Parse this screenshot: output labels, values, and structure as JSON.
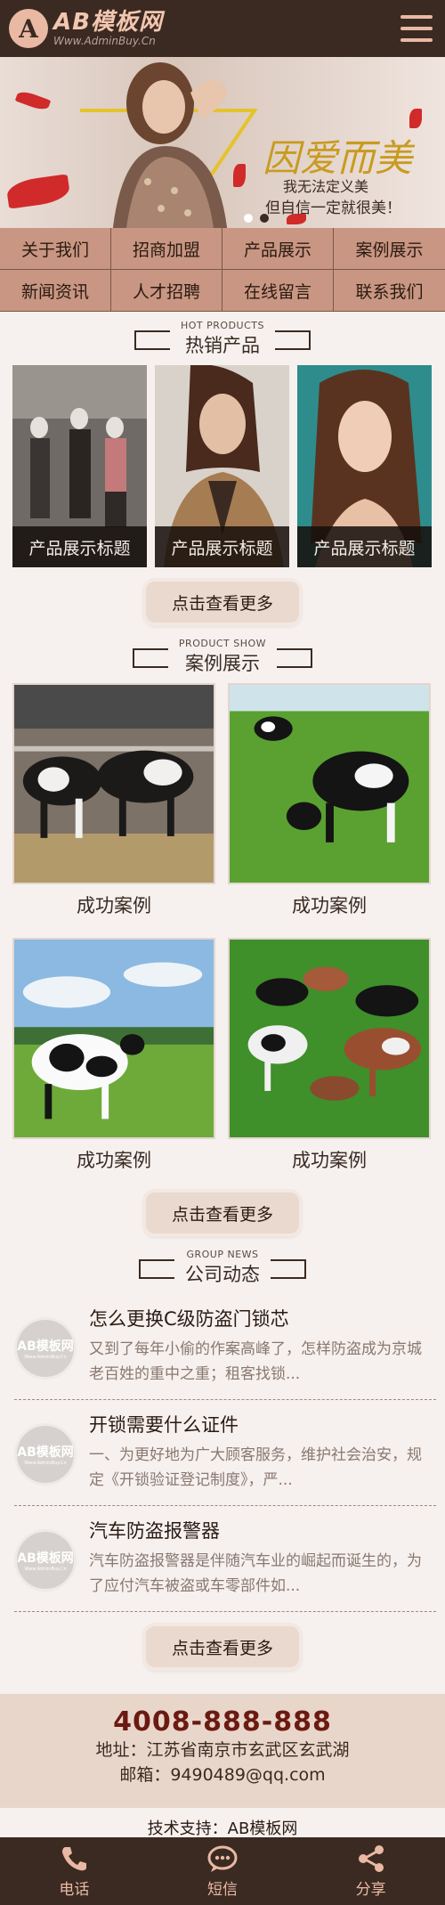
{
  "header": {
    "logo_mark": "A",
    "logo_name": "AB模板网",
    "logo_url": "Www.AdminBuy.Cn"
  },
  "banner": {
    "title": "因爱而美",
    "sub1": "我无法定义美",
    "sub2": "但自信一定就很美！"
  },
  "nav": [
    "关于我们",
    "招商加盟",
    "产品展示",
    "案例展示",
    "新闻资讯",
    "人才招聘",
    "在线留言",
    "联系我们"
  ],
  "hot": {
    "en": "HOT PRODUCTS",
    "cn": "热销产品",
    "items": [
      "产品展示标题",
      "产品展示标题",
      "产品展示标题"
    ],
    "more": "点击查看更多"
  },
  "cases": {
    "en": "PRODUCT SHOW",
    "cn": "案例展示",
    "items": [
      "成功案例",
      "成功案例",
      "成功案例",
      "成功案例"
    ],
    "more": "点击查看更多"
  },
  "news": {
    "en": "GROUP NEWS",
    "cn": "公司动态",
    "thumb_name": "AB模板网",
    "thumb_url": "Www.AdminBuy.Cn",
    "items": [
      {
        "title": "怎么更换C级防盗门锁芯",
        "desc": "又到了每年小偷的作案高峰了，怎样防盗成为京城老百姓的重中之重；租客找锁..."
      },
      {
        "title": "开锁需要什么证件",
        "desc": "一、为更好地为广大顾客服务，维护社会治安，规定《开锁验证登记制度》，严..."
      },
      {
        "title": "汽车防盗报警器",
        "desc": "汽车防盗报警器是伴随汽车业的崛起而诞生的，为了应付汽车被盗或车零部件如..."
      }
    ],
    "more": "点击查看更多"
  },
  "contact": {
    "phone": "4008-888-888",
    "address": "地址：江苏省南京市玄武区玄武湖",
    "email": "邮箱：9490489@qq.com"
  },
  "support": "技术支持：AB模板网",
  "footer": {
    "call": "电话",
    "sms": "短信",
    "share": "分享"
  }
}
